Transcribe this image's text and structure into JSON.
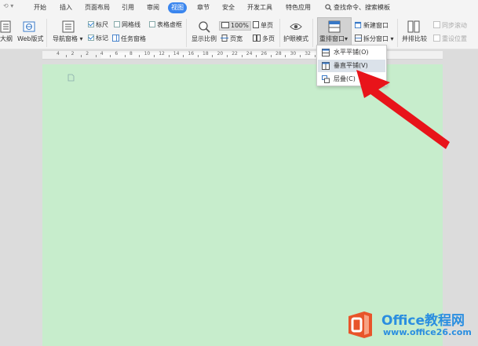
{
  "menu": {
    "history_icon": "undo-history-icon",
    "tabs": [
      {
        "label": "开始"
      },
      {
        "label": "插入"
      },
      {
        "label": "页面布局"
      },
      {
        "label": "引用"
      },
      {
        "label": "审阅"
      },
      {
        "label": "视图",
        "active": true
      },
      {
        "label": "章节"
      },
      {
        "label": "安全"
      },
      {
        "label": "开发工具"
      },
      {
        "label": "特色应用"
      }
    ],
    "search_label": "查找命令、搜索模板"
  },
  "ribbon": {
    "outline_label": "大纲",
    "web_layout_label": "Web版式",
    "nav_pane_label": "导航窗格",
    "ruler_label": "标尺",
    "gridlines_label": "网格线",
    "table_gridlines_label": "表格虚框",
    "marks_label": "标记",
    "task_pane_label": "任务窗格",
    "zoom_label": "显示比例",
    "zoom_value": "100%",
    "single_page_label": "单页",
    "page_width_label": "页宽",
    "multi_page_label": "多页",
    "eye_mode_label": "护眼模式",
    "arrange_window_label": "重排窗口",
    "new_window_label": "新建窗口",
    "split_window_label": "拆分窗口",
    "side_by_side_label": "并排比较",
    "sync_scroll_label": "同步滚动",
    "reset_position_label": "重设位置",
    "checkboxes": {
      "ruler": true,
      "gridlines": false,
      "table_gridlines": false,
      "marks": true,
      "task_pane": false
    }
  },
  "ruler": {
    "labels": [
      "4",
      "2",
      "2",
      "4",
      "6",
      "8",
      "10",
      "12",
      "14",
      "16",
      "18",
      "20",
      "22",
      "24",
      "26",
      "28",
      "30",
      "32",
      "34"
    ]
  },
  "dropdown": {
    "items": [
      {
        "label": "水平平铺(O)",
        "icon": "tile-horizontal-icon"
      },
      {
        "label": "垂直平铺(V)",
        "icon": "tile-vertical-icon",
        "highlighted": true
      },
      {
        "label": "层叠(C)",
        "icon": "cascade-icon"
      }
    ]
  },
  "watermark": {
    "title": "Office教程网",
    "url": "www.office26.com"
  },
  "colors": {
    "active_tab": "#3b86ee",
    "page_background": "#c7edcc",
    "arrow": "#e8141a",
    "watermark": "#2a8ee0",
    "logo": "#e8542a"
  }
}
